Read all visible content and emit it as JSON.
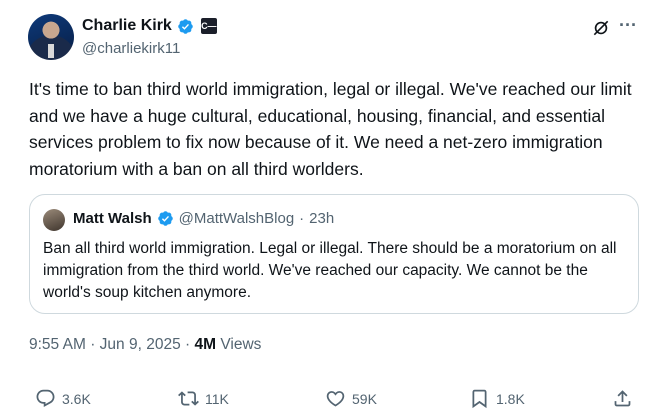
{
  "author": {
    "display_name": "Charlie Kirk",
    "handle": "@charliekirk11",
    "affiliation_badge": "C—"
  },
  "tweet": {
    "text": "It's time to ban third world immigration, legal or illegal. We've reached our limit and we have a huge cultural, educational, housing, financial, and essential services problem to fix now because of it. We need a net-zero immigration moratorium with a ban on all third worlders."
  },
  "quote": {
    "display_name": "Matt Walsh",
    "handle": "@MattWalshBlog",
    "separator": "·",
    "time": "23h",
    "text": "Ban all third world immigration. Legal or illegal. There should be a moratorium on all immigration from the third world. We've reached our capacity. We cannot be the world's soup kitchen anymore."
  },
  "meta": {
    "time": "9:55 AM",
    "separator1": "·",
    "date": "Jun 9, 2025",
    "separator2": "·",
    "views_count": "4M",
    "views_label": "Views"
  },
  "actions": {
    "replies": "3.6K",
    "reposts": "11K",
    "likes": "59K",
    "bookmarks": "1.8K"
  },
  "colors": {
    "verified_blue": "#1d9bf0",
    "secondary_text": "#536471",
    "primary_text": "#0f1419",
    "border": "#cfd9de"
  },
  "icons": [
    "verified-icon",
    "grok-icon",
    "more-icon",
    "reply-icon",
    "retweet-icon",
    "like-icon",
    "bookmark-icon",
    "share-icon"
  ]
}
